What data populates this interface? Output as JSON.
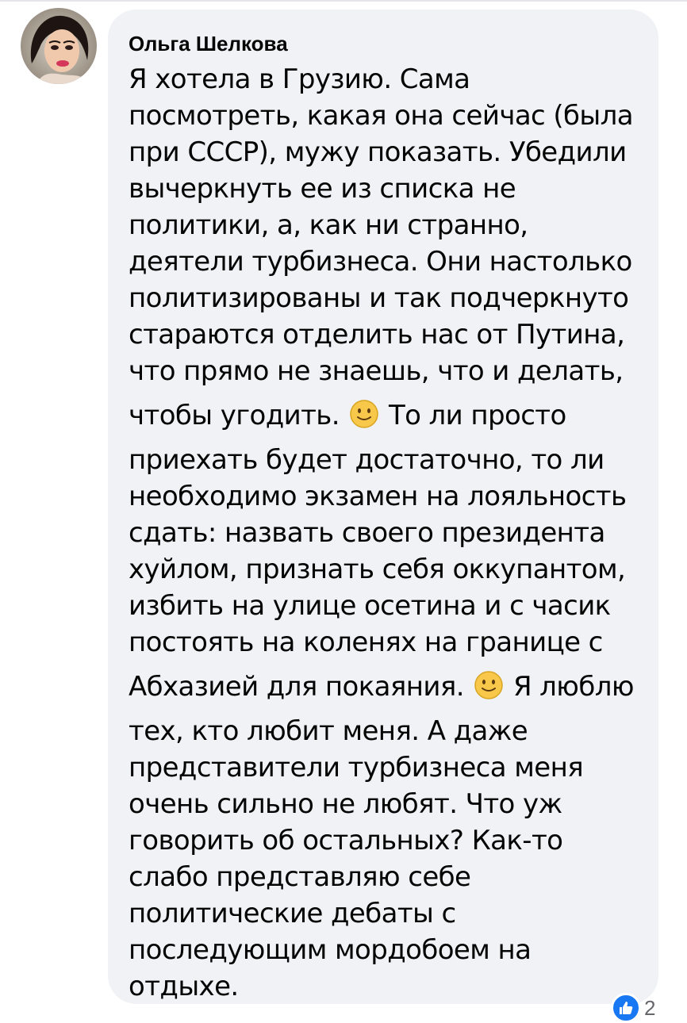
{
  "comment": {
    "author": "Ольга Шелкова",
    "lines": [
      "Я хотела в Грузию. Сама",
      "посмотреть, какая она сейчас (была",
      "при СССР), мужу показать. Убедили",
      "вычеркнуть ее из списка не",
      "политики, а, как ни странно,",
      "деятели турбизнеса. Они настолько",
      "политизированы и так подчеркнуто",
      "стараются отделить нас от Путина,",
      "что прямо не знаешь, что и делать,"
    ],
    "emoji_line_1": {
      "before": "чтобы угодить.",
      "emoji": "slightly-smiling-face-icon",
      "after": "То ли просто"
    },
    "lines_2": [
      "приехать будет достаточно, то ли",
      "необходимо экзамен на лояльность",
      "сдать: назвать своего президента",
      "хуйлом, признать себя оккупантом,",
      "избить на улице осетина и с часик",
      "постоять на коленях на границе с"
    ],
    "emoji_line_2": {
      "before": "Абхазией для покаяния.",
      "emoji": "slightly-smiling-face-icon",
      "after": "Я люблю"
    },
    "lines_3": [
      "тех, кто любит меня. А даже",
      "представители турбизнеса меня",
      "очень сильно не любят. Что уж",
      "говорить об остальных? Как-то",
      "слабо представляю себе",
      "политические дебаты с",
      "последующим мордобоем на",
      "отдыхе."
    ]
  },
  "reactions": {
    "icon": "like-icon",
    "count": "2",
    "color": "#1877f2"
  },
  "colors": {
    "bubble": "#f0f2f5",
    "text": "#050505",
    "emoji_face": "#f7c84a"
  }
}
